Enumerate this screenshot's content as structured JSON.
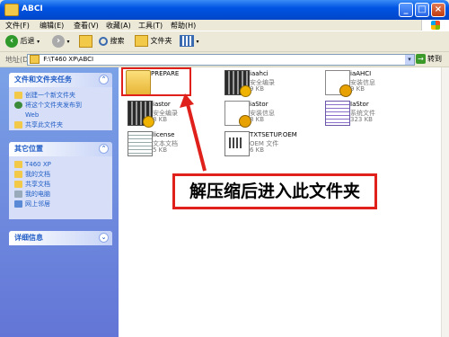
{
  "window": {
    "title": "ABCI"
  },
  "title_buttons": {
    "minimize": "_",
    "maximize": "□",
    "close": "×"
  },
  "menu": {
    "items": [
      "文件(F)",
      "编辑(E)",
      "查看(V)",
      "收藏(A)",
      "工具(T)",
      "帮助(H)"
    ]
  },
  "toolbar": {
    "back": "后退",
    "search": "搜索",
    "folders": "文件夹"
  },
  "address": {
    "label": "地址(D)",
    "value": "F:\\T460 XP\\ABCI",
    "go": "转到"
  },
  "sidebar": {
    "tasks": {
      "title": "文件和文件夹任务",
      "items": [
        "创建一个新文件夹",
        "将这个文件夹发布到",
        "Web",
        "共享此文件夹"
      ]
    },
    "places": {
      "title": "其它位置",
      "items": [
        "T460 XP",
        "我的文档",
        "共享文档",
        "我的电脑",
        "网上邻居"
      ]
    },
    "details": {
      "title": "详细信息"
    }
  },
  "files": [
    {
      "name": "PREPARE",
      "type": "",
      "size": "",
      "icon": "folder-icon"
    },
    {
      "name": "iaahci",
      "type": "安全编录",
      "size": "9 KB",
      "icon": "security-catalog-icon"
    },
    {
      "name": "iaAHCI",
      "type": "安装信息",
      "size": "9 KB",
      "icon": "setup-info-icon"
    },
    {
      "name": "iastor",
      "type": "安全编录",
      "size": "8 KB",
      "icon": "security-catalog-icon"
    },
    {
      "name": "iaStor",
      "type": "安装信息",
      "size": "8 KB",
      "icon": "setup-info-icon"
    },
    {
      "name": "IaStor",
      "type": "系统文件",
      "size": "323 KB",
      "icon": "system-file-icon"
    },
    {
      "name": "license",
      "type": "文本文档",
      "size": "5 KB",
      "icon": "text-document-icon"
    },
    {
      "name": "TXTSETUP.OEM",
      "type": "OEM 文件",
      "size": "6 KB",
      "icon": "oem-file-icon"
    }
  ],
  "annotation": {
    "text": "解压缩后进入此文件夹",
    "color": "#e0211b"
  }
}
